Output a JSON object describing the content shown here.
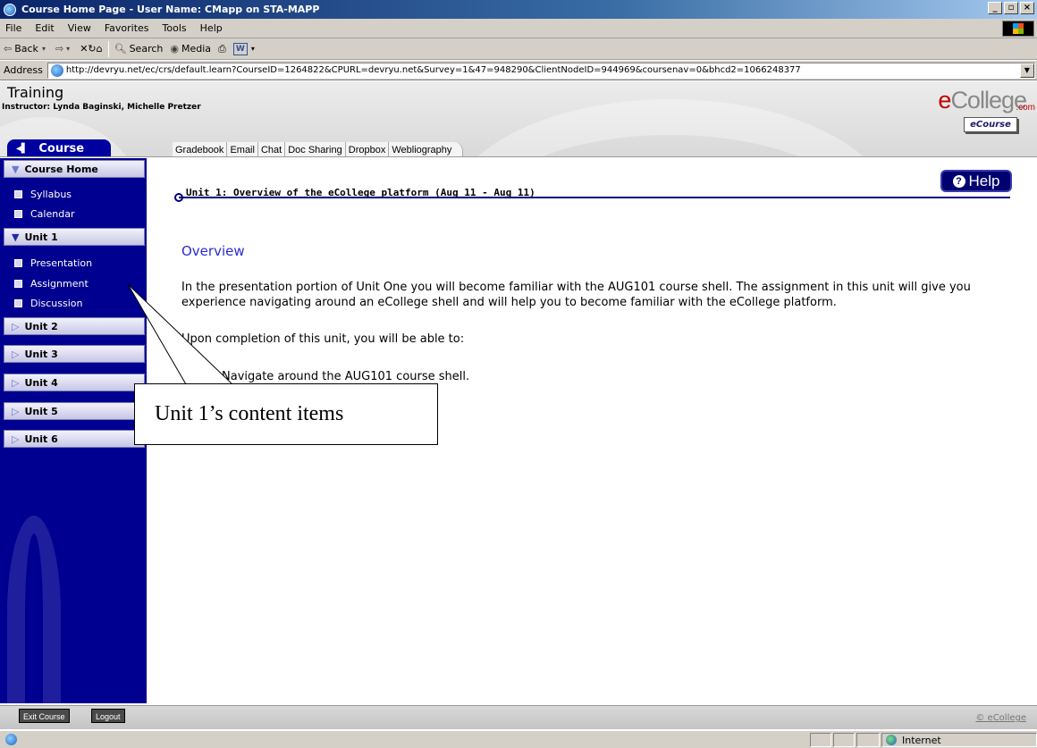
{
  "window": {
    "title": "Course Home Page - User Name: CMapp on STA-MAPP",
    "buttons": {
      "minimize": "_",
      "maximize": "▫",
      "close": "×"
    }
  },
  "menu": [
    "File",
    "Edit",
    "View",
    "Favorites",
    "Tools",
    "Help"
  ],
  "toolbar": {
    "back": "Back",
    "search": "Search",
    "media": "Media"
  },
  "address": {
    "label": "Address",
    "url": "http://devryu.net/ec/crs/default.learn?CourseID=1264822&CPURL=devryu.net&Survey=1&47=948290&ClientNodeID=944969&coursenav=0&bhcd2=1066248377"
  },
  "header": {
    "course_title": "Training",
    "instructor": "Instructor: Lynda Baginski, Michelle Pretzer",
    "logo_e": "e",
    "logo_rest": "College",
    "logo_com": ".com",
    "ecourse": "eCourse",
    "course_tab": "Course",
    "tools": [
      "Gradebook",
      "Email",
      "Chat",
      "Doc Sharing",
      "Dropbox",
      "Webliography"
    ]
  },
  "sidebar": {
    "course_home": "Course Home",
    "top_items": [
      "Syllabus",
      "Calendar"
    ],
    "unit1": "Unit 1",
    "unit1_items": [
      "Presentation",
      "Assignment",
      "Discussion"
    ],
    "units": [
      "Unit 2",
      "Unit 3",
      "Unit 4",
      "Unit 5",
      "Unit 6"
    ]
  },
  "main": {
    "help": "Help",
    "unit_header": "Unit 1:  Overview of the eCollege platform (Aug 11 - Aug 11)",
    "overview_title": "Overview",
    "para1": "In the presentation portion of Unit One you will become familiar with the AUG101 course shell. The assignment in this unit will give you experience navigating around an eCollege shell and will help you to become familiar with the eCollege platform.",
    "para2": "Upon completion of this unit, you will be able to:",
    "para3": "Navigate around the AUG101 course shell."
  },
  "callout": {
    "text": "Unit 1’s content items"
  },
  "footer": {
    "exit": "Exit Course",
    "logout": "Logout",
    "copyright": "© eCollege"
  },
  "status": {
    "zone": "Internet"
  }
}
